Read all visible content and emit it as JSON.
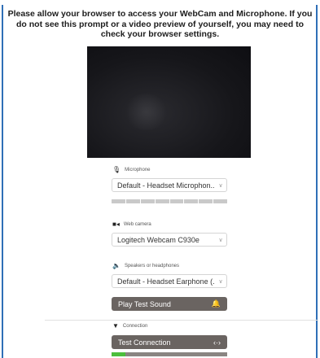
{
  "prompt": {
    "text": "Please allow your browser to access your WebCam and Microphone. If you do not see this prompt or a video preview of yourself, you may need to check your browser settings."
  },
  "microphone": {
    "label": "Microphone",
    "icon": "microphone-icon",
    "selected": "Default - Headset Microphon...",
    "level_percent": 0
  },
  "webcam": {
    "label": "Web camera",
    "icon": "video-camera-icon",
    "selected": "Logitech Webcam C930e"
  },
  "speakers": {
    "label": "Speakers or headphones",
    "icon": "speaker-icon",
    "selected": "Default - Headset Earphone (...",
    "test_button": "Play Test Sound",
    "test_icon": "bell-icon"
  },
  "connection": {
    "label": "Connection",
    "icon": "wifi-icon",
    "test_button": "Test Connection",
    "test_icon": "connection-arrows-icon",
    "progress_percent": 12
  },
  "colors": {
    "button_bg": "#6a6461",
    "progress_fill": "#4cbf3c",
    "frame_border": "#2f6fb7"
  }
}
